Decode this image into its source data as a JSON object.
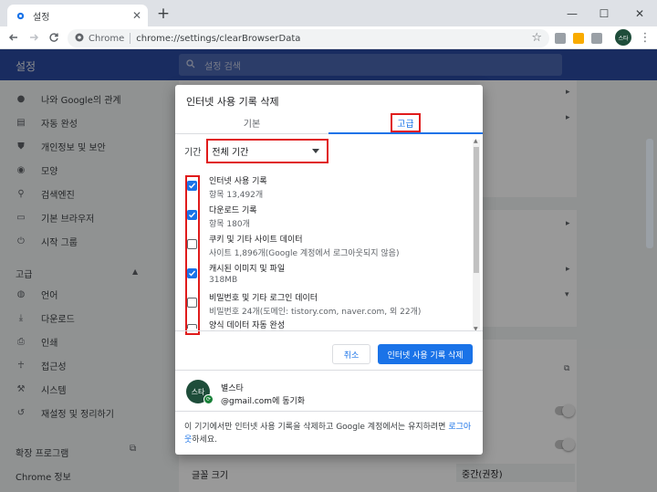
{
  "browser": {
    "tab_title": "설정",
    "omnibox_site": "Chrome",
    "omnibox_url": "chrome://settings/clearBrowserData",
    "profile_initials": "스타"
  },
  "settings": {
    "header_title": "설정",
    "search_placeholder": "설정 검색",
    "sidebar": [
      {
        "label": "나와 Google의 관계",
        "icon": "person-icon"
      },
      {
        "label": "자동 완성",
        "icon": "clipboard-icon"
      },
      {
        "label": "개인정보 및 보안",
        "icon": "shield-icon"
      },
      {
        "label": "모양",
        "icon": "palette-icon"
      },
      {
        "label": "검색엔진",
        "icon": "search-icon"
      },
      {
        "label": "기본 브라우저",
        "icon": "browser-icon"
      },
      {
        "label": "시작 그룹",
        "icon": "power-icon"
      }
    ],
    "advanced_section": "고급",
    "advanced_items": [
      {
        "label": "언어",
        "icon": "globe-icon"
      },
      {
        "label": "다운로드",
        "icon": "download-icon"
      },
      {
        "label": "인쇄",
        "icon": "printer-icon"
      },
      {
        "label": "접근성",
        "icon": "accessibility-icon"
      },
      {
        "label": "시스템",
        "icon": "wrench-icon"
      },
      {
        "label": "재설정 및 정리하기",
        "icon": "history-icon"
      }
    ],
    "extensions": "확장 프로그램",
    "about": "Chrome 정보",
    "font_size_label": "글꼴 크기",
    "font_size_value": "중간(권장)"
  },
  "dialog": {
    "title": "인터넷 사용 기록 삭제",
    "tab_basic": "기본",
    "tab_advanced": "고급",
    "time_range_label": "기간",
    "time_range_value": "전체 기간",
    "items": [
      {
        "title": "인터넷 사용 기록",
        "subtitle": "항목 13,492개",
        "checked": true
      },
      {
        "title": "다운로드 기록",
        "subtitle": "항목 180개",
        "checked": true
      },
      {
        "title": "쿠키 및 기타 사이트 데이터",
        "subtitle": "사이트 1,896개(Google 계정에서 로그아웃되지 않음)",
        "checked": false
      },
      {
        "title": "캐시된 이미지 및 파일",
        "subtitle": "318MB",
        "checked": true
      },
      {
        "title": "비밀번호 및 기타 로그인 데이터",
        "subtitle": "비밀번호 24개(도메인: tistory.com, naver.com, 외 22개)",
        "checked": false
      },
      {
        "title": "양식 데이터 자동 완성",
        "subtitle": "",
        "checked": false
      }
    ],
    "cancel": "취소",
    "clear": "인터넷 사용 기록 삭제",
    "account_name": "별스타",
    "account_email": "@gmail.com에 동기화",
    "footer_text": "이 기기에서만 인터넷 사용 기록을 삭제하고 Google 계정에서는 유지하려면 ",
    "footer_link": "로그아웃",
    "footer_tail": "하세요."
  },
  "colors": {
    "accent": "#1a73e8",
    "highlight": "#e01b1b",
    "header": "#2b4aa0"
  }
}
